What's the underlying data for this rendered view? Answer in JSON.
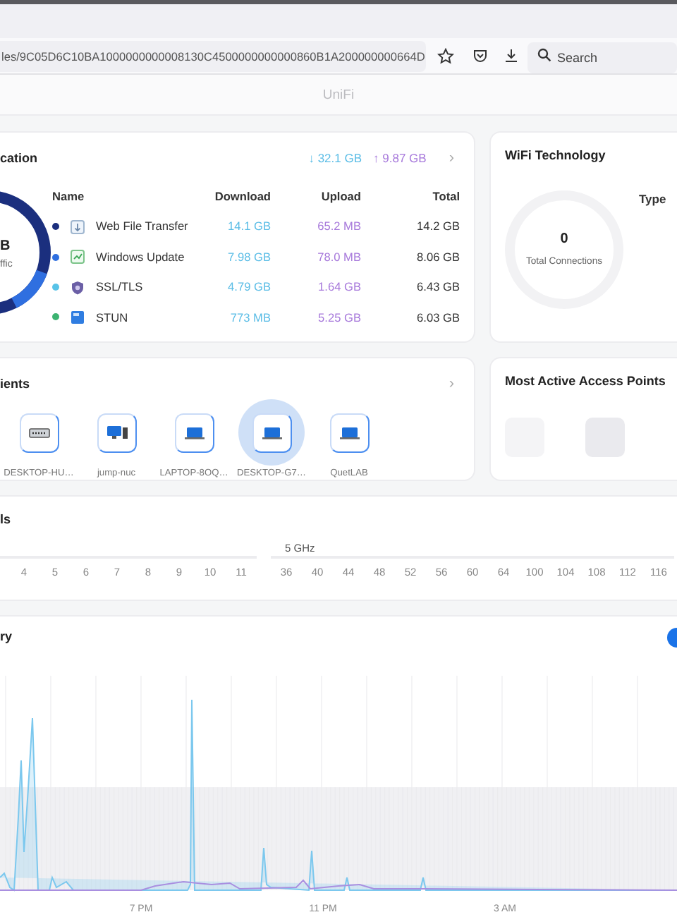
{
  "browser": {
    "url": "les/9C05D6C10BA1000000000008130C4500000000000860B1A200000000664D",
    "search_placeholder": "Search"
  },
  "page_title": "UniFi",
  "applications": {
    "title": "cation",
    "total_download": "↓ 32.1 GB",
    "total_upload": "↑ 9.87 GB",
    "more": "›",
    "donut_value": "B",
    "donut_caption": "ffic",
    "columns": [
      "Name",
      "Download",
      "Upload",
      "Total"
    ],
    "rows": [
      {
        "kind": "file",
        "name": "Web File Transfer",
        "download": "14.1 GB",
        "upload": "65.2 MB",
        "total": "14.2 GB",
        "color": "#1b2f7e"
      },
      {
        "kind": "update",
        "name": "Windows Update",
        "download": "7.98 GB",
        "upload": "78.0 MB",
        "total": "8.06 GB",
        "color": "#2f6fe0"
      },
      {
        "kind": "shield",
        "name": "SSL/TLS",
        "download": "4.79 GB",
        "upload": "1.64 GB",
        "total": "6.43 GB",
        "color": "#58c3e8"
      },
      {
        "kind": "stun",
        "name": "STUN",
        "download": "773 MB",
        "upload": "5.25 GB",
        "total": "6.03 GB",
        "color": "#3cb371"
      }
    ]
  },
  "wifi_technology": {
    "title": "WiFi Technology",
    "type_heading": "Type",
    "connections": "0",
    "connections_label": "Total Connections"
  },
  "clients": {
    "title": "ients",
    "more": "›",
    "items": [
      {
        "kind": "server",
        "name": "DESKTOP-HU…",
        "selected": false
      },
      {
        "kind": "desktop",
        "name": "jump-nuc",
        "selected": false
      },
      {
        "kind": "laptop",
        "name": "LAPTOP-8OQ…",
        "selected": false
      },
      {
        "kind": "laptop",
        "name": "DESKTOP-G7…",
        "selected": true
      },
      {
        "kind": "laptop",
        "name": "QuetLAB",
        "selected": false
      }
    ]
  },
  "access_points": {
    "title": "Most Active Access Points",
    "tiles": [
      {
        "kind": "faint"
      },
      {
        "kind": "shaded"
      }
    ]
  },
  "channels": {
    "title": "ls",
    "bands": [
      {
        "channels": [
          "4",
          "5",
          "6",
          "7",
          "8",
          "9",
          "10",
          "11"
        ]
      },
      {
        "label": "5 GHz",
        "channels": [
          "36",
          "40",
          "44",
          "48",
          "52",
          "56",
          "60",
          "64",
          "100",
          "104",
          "108",
          "112",
          "116"
        ]
      }
    ]
  },
  "history": {
    "title": "ry",
    "toggle": {
      "on": true
    },
    "time_labels": [
      "7 PM",
      "11 PM",
      "3 AM"
    ]
  }
}
